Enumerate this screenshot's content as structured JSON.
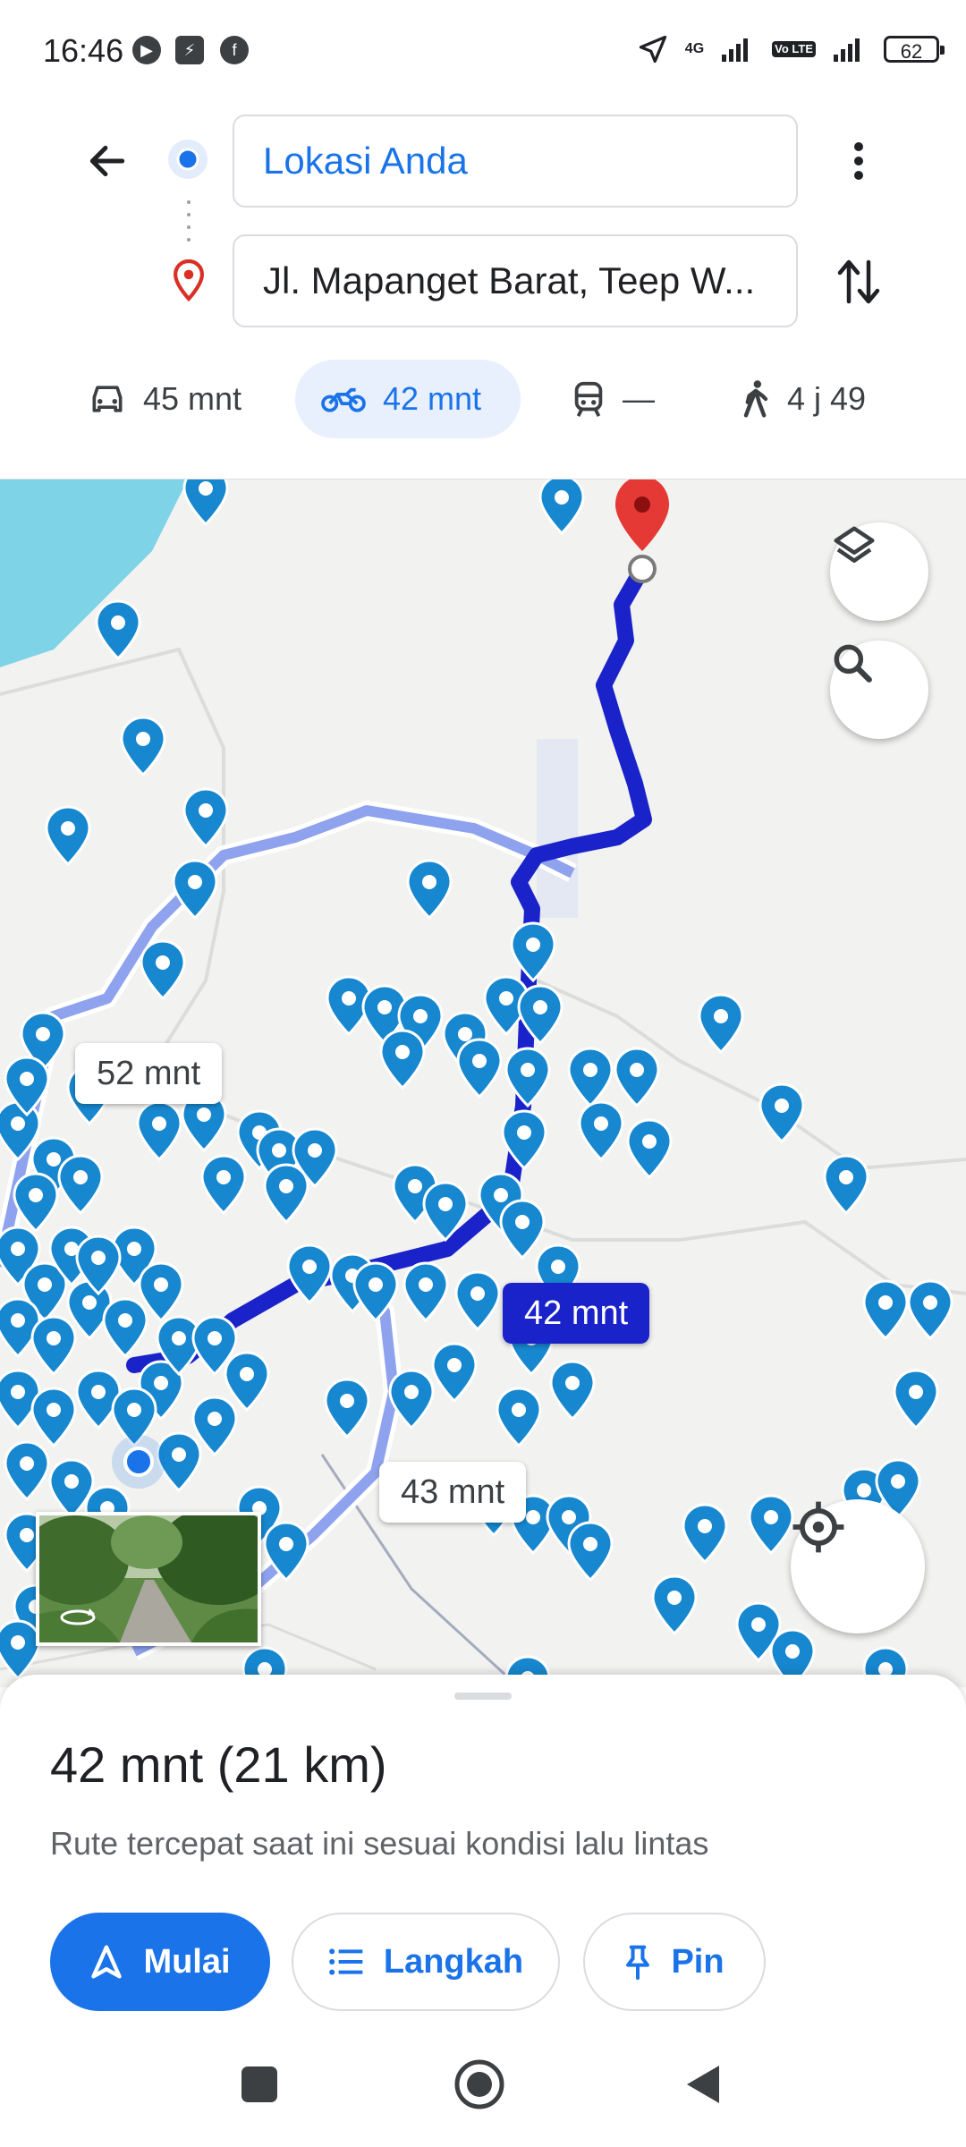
{
  "status_bar": {
    "time": "16:46",
    "network_label": "4G",
    "volte_label": "Vo LTE",
    "battery": "62"
  },
  "search": {
    "origin": "Lokasi Anda",
    "destination": "Jl. Mapanget Barat, Teep W..."
  },
  "modes": [
    {
      "icon": "car-icon",
      "label": "45 mnt",
      "selected": false
    },
    {
      "icon": "motorcycle-icon",
      "label": "42 mnt",
      "selected": true
    },
    {
      "icon": "transit-icon",
      "label": "—",
      "selected": false
    },
    {
      "icon": "walk-icon",
      "label": "4 j 49",
      "selected": false
    }
  ],
  "map": {
    "route_labels": {
      "primary": "42 mnt",
      "alternate_1": "52 mnt",
      "alternate_2": "43 mnt"
    },
    "colors": {
      "route_primary": "#1a22c9",
      "route_alternate": "#8fa2ee",
      "pin_blue": "#1787cf",
      "destination_pin": "#e53935",
      "water": "#7fd3e6"
    }
  },
  "sheet": {
    "summary": "42 mnt (21 km)",
    "note": "Rute tercepat saat ini sesuai kondisi lalu lintas",
    "buttons": {
      "start": "Mulai",
      "steps": "Langkah",
      "pin": "Pin"
    }
  }
}
